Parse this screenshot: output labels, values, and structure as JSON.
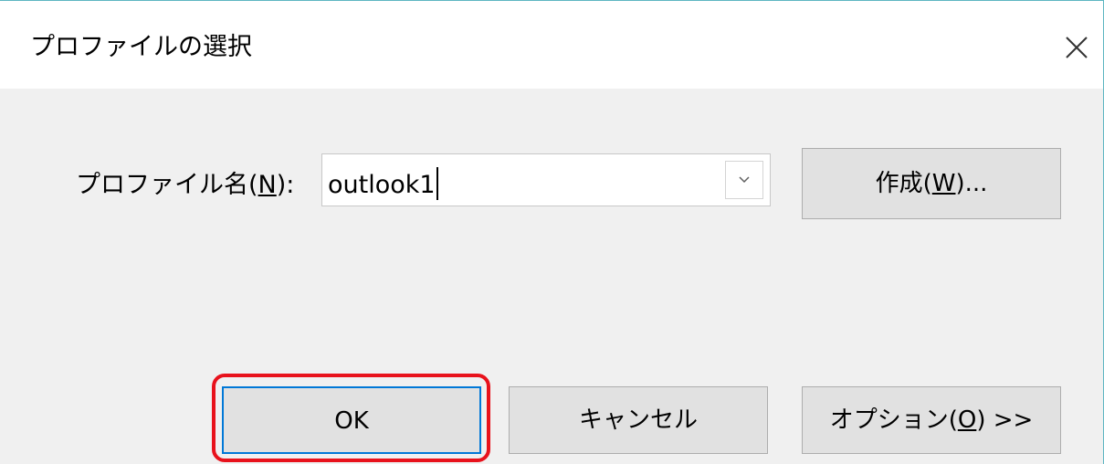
{
  "dialog": {
    "title": "プロファイルの選択",
    "close_icon": "close-icon"
  },
  "profile": {
    "label_prefix": "プロファイル名(",
    "label_accel": "N",
    "label_suffix": "):",
    "value": "outlook1",
    "dropdown_icon": "chevron-down-icon"
  },
  "buttons": {
    "create_prefix": "作成(",
    "create_accel": "W",
    "create_suffix": ")...",
    "ok": "OK",
    "cancel": "キャンセル",
    "options_prefix": "オプション(",
    "options_accel": "O",
    "options_suffix": ") >>"
  },
  "colors": {
    "accent": "#0078d7",
    "highlight": "#e8121c",
    "dialog_bg": "#f0f0f0",
    "button_bg": "#e1e1e1"
  }
}
